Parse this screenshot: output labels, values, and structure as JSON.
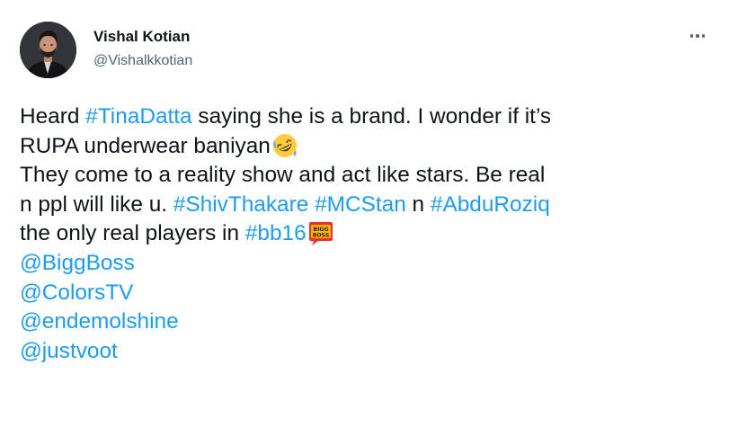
{
  "author": {
    "name": "Vishal Kotian",
    "handle": "@Vishalkkotian"
  },
  "menu": {
    "icon": "more-horizontal-icon"
  },
  "tweet": {
    "line1": {
      "t1": "Heard ",
      "l1": "#TinaDatta",
      "t2": " saying she is a brand. I wonder if it’s"
    },
    "line2": {
      "t1": "RUPA underwear baniyan",
      "emoji": "rolling-on-floor-laughing-emoji"
    },
    "line3": {
      "t1": "They come to a reality show and act like stars. Be real"
    },
    "line4": {
      "t1": "n ppl will like u. ",
      "l1": "#ShivThakare",
      "t2": " ",
      "l2": "#MCStan",
      "t3": " n ",
      "l3": "#AbduRoziq"
    },
    "line5": {
      "t1": "the only real players in ",
      "l1": "#bb16",
      "emoji_text": "BIGG BOSS"
    },
    "mentions": [
      "@BiggBoss",
      "@ColorsTV",
      "@endemolshine",
      "@justvoot"
    ]
  },
  "colors": {
    "link": "#1d9bf0",
    "text": "#0f1419",
    "secondary": "#536471"
  }
}
